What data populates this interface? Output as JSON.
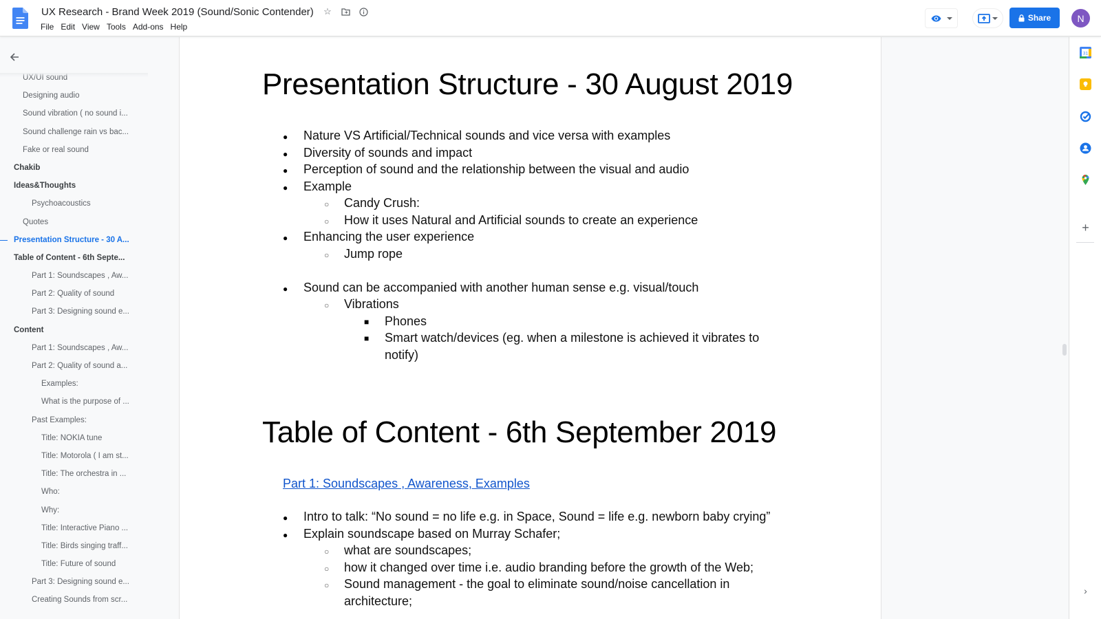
{
  "app": {
    "title": "UX Research - Brand Week 2019 (Sound/Sonic Contender)",
    "menu": [
      "File",
      "Edit",
      "View",
      "Tools",
      "Add-ons",
      "Help"
    ],
    "share_label": "Share",
    "avatar_initial": "N",
    "icons": {
      "logo": "google-docs-icon",
      "star": "star-icon",
      "move": "folder-move-icon",
      "status": "info-icon",
      "view_mode": "eye-icon",
      "present": "present-icon",
      "share_lock": "lock-icon"
    },
    "colors": {
      "accent": "#1a73e8",
      "avatar": "#7e57c2",
      "link": "#1155cc"
    }
  },
  "outline": {
    "back_icon": "arrow-left-icon",
    "items": [
      {
        "label": "UX/UI sound",
        "level": 2
      },
      {
        "label": "Designing audio",
        "level": 2
      },
      {
        "label": "Sound vibration ( no sound i...",
        "level": 2
      },
      {
        "label": "Sound challenge rain vs bac...",
        "level": 2
      },
      {
        "label": "Fake or real sound",
        "level": 2
      },
      {
        "label": "Chakib",
        "level": 1
      },
      {
        "label": "Ideas&Thoughts",
        "level": 1
      },
      {
        "label": "Psychoacoustics",
        "level": 3
      },
      {
        "label": "Quotes",
        "level": 2
      },
      {
        "label": "Presentation Structure - 30 A...",
        "level": 1,
        "active": true
      },
      {
        "label": "Table of Content - 6th Septe...",
        "level": 1
      },
      {
        "label": "Part 1: Soundscapes , Aw...",
        "level": 3
      },
      {
        "label": "Part 2: Quality of sound",
        "level": 3
      },
      {
        "label": "Part 3: Designing sound e...",
        "level": 3
      },
      {
        "label": "Content",
        "level": 1
      },
      {
        "label": "Part 1: Soundscapes , Aw...",
        "level": 3
      },
      {
        "label": "Part 2: Quality of sound a...",
        "level": 3
      },
      {
        "label": "Examples:",
        "level": 4
      },
      {
        "label": "What is the purpose of ...",
        "level": 4
      },
      {
        "label": "Past Examples:",
        "level": 3
      },
      {
        "label": "Title: NOKIA tune",
        "level": 4
      },
      {
        "label": "Title: Motorola ( I am st...",
        "level": 4
      },
      {
        "label": "Title: The orchestra in ...",
        "level": 4
      },
      {
        "label": "Who:",
        "level": 4
      },
      {
        "label": "Why:",
        "level": 4
      },
      {
        "label": "Title: Interactive Piano ...",
        "level": 4
      },
      {
        "label": "Title: Birds singing traff...",
        "level": 4
      },
      {
        "label": "Title: Future of sound",
        "level": 4
      },
      {
        "label": "Part 3: Designing sound e...",
        "level": 3
      },
      {
        "label": "Creating Sounds from scr...",
        "level": 3
      }
    ]
  },
  "document": {
    "section1": {
      "heading": "Presentation Structure - 30 August 2019",
      "items": [
        {
          "text": "Nature VS Artificial/Technical sounds and vice versa with examples",
          "level": 1
        },
        {
          "text": "Diversity of sounds and impact",
          "level": 1
        },
        {
          "text": "Perception of sound and the relationship between the visual and audio",
          "level": 1
        },
        {
          "text": "Example",
          "level": 1
        },
        {
          "text": "Candy Crush:",
          "level": 2
        },
        {
          "text": "How it uses Natural and Artificial sounds to create an experience",
          "level": 2
        },
        {
          "text": "Enhancing the user experience",
          "level": 1
        },
        {
          "text": "Jump rope",
          "level": 2
        },
        {
          "text": "Sound can be accompanied with another human sense e.g. visual/touch",
          "level": 1
        },
        {
          "text": "Vibrations",
          "level": 2
        },
        {
          "text": "Phones",
          "level": 3
        },
        {
          "text": "Smart watch/devices (eg. when a milestone is achieved it vibrates to",
          "level": 3
        },
        {
          "text": "notify)",
          "level": 3,
          "continuation": true
        }
      ]
    },
    "section2": {
      "heading": "Table of Content - 6th September 2019",
      "link": "Part 1: Soundscapes , Awareness, Examples",
      "items": [
        {
          "text": "Intro to talk: “No sound = no life e.g. in Space, Sound = life e.g. newborn baby crying”",
          "level": 1
        },
        {
          "text": "Explain soundscape based on Murray Schafer;",
          "level": 1
        },
        {
          "text": "what are soundscapes;",
          "level": 2
        },
        {
          "text": "how it changed over time i.e. audio branding before the growth of the Web;",
          "level": 2
        },
        {
          "text": "Sound management - the goal to eliminate sound/noise cancellation in",
          "level": 2
        },
        {
          "text": "architecture;",
          "level": 2,
          "continuation": true
        }
      ]
    }
  },
  "side_panel": {
    "icons": [
      "calendar-icon",
      "keep-icon",
      "tasks-icon",
      "contacts-icon",
      "maps-icon",
      "add-icon"
    ],
    "expand_icon": "chevron-right-icon"
  }
}
